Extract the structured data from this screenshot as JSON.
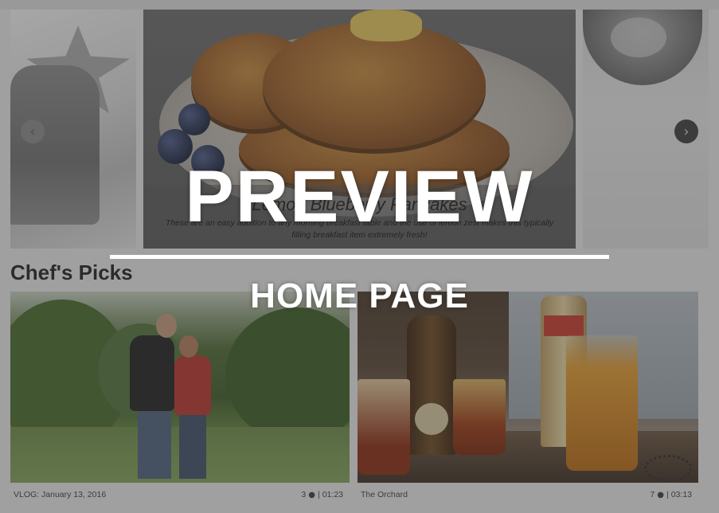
{
  "carousel": {
    "featured": {
      "title": "Lemon Blueberry Pancakes",
      "description": "These are an easy addition to any morning breakfast table and the use of lemon zest makes this typically filling breakfast item extremely fresh!"
    },
    "prev_glyph": "‹",
    "next_glyph": "›"
  },
  "section": {
    "title": "Chef's Picks"
  },
  "cards": [
    {
      "title": "VLOG: January 13, 2016",
      "views": "3",
      "duration": "01:23"
    },
    {
      "title": "The Orchard",
      "views": "7",
      "duration": "03:13"
    }
  ],
  "icons": {
    "views": "eye-icon",
    "separator": "|"
  },
  "watermark": {
    "title": "PREVIEW",
    "subtitle": "HOME PAGE"
  },
  "colors": {
    "background": "#e9e9e9",
    "overlay": "#3c3c3c",
    "watermark": "#ffffff"
  }
}
